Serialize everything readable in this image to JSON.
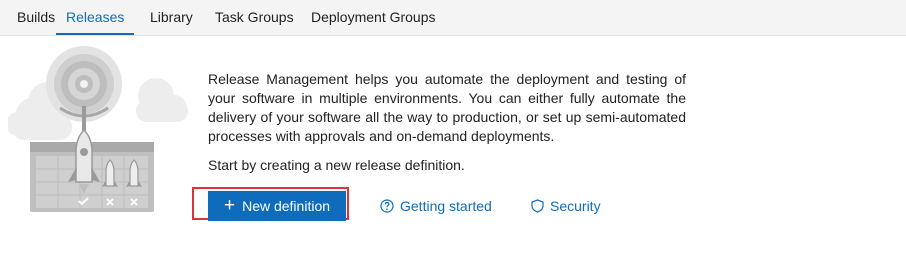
{
  "tabs": [
    {
      "label": "Builds"
    },
    {
      "label": "Releases",
      "active": true
    },
    {
      "label": "Library"
    },
    {
      "label": "Task Groups"
    },
    {
      "label": "Deployment Groups"
    }
  ],
  "main": {
    "description": "Release Management helps you automate the deployment and testing of your software in multiple environments. You can either fully automate the delivery of your software all the way to production, or set up semi-automated processes with approvals and on-demand deployments.",
    "start_text": "Start by creating a new release definition.",
    "new_definition_label": "New definition",
    "getting_started_label": "Getting started",
    "security_label": "Security"
  },
  "icons": {
    "plus": "plus-icon",
    "getting_started": "question-circle-icon",
    "security": "shield-icon",
    "illustration": "rocket-launch-illustration"
  },
  "colors": {
    "accent": "#0f6cbd",
    "highlight": "#e0303a",
    "tabbar_bg": "#f4f4f4"
  }
}
